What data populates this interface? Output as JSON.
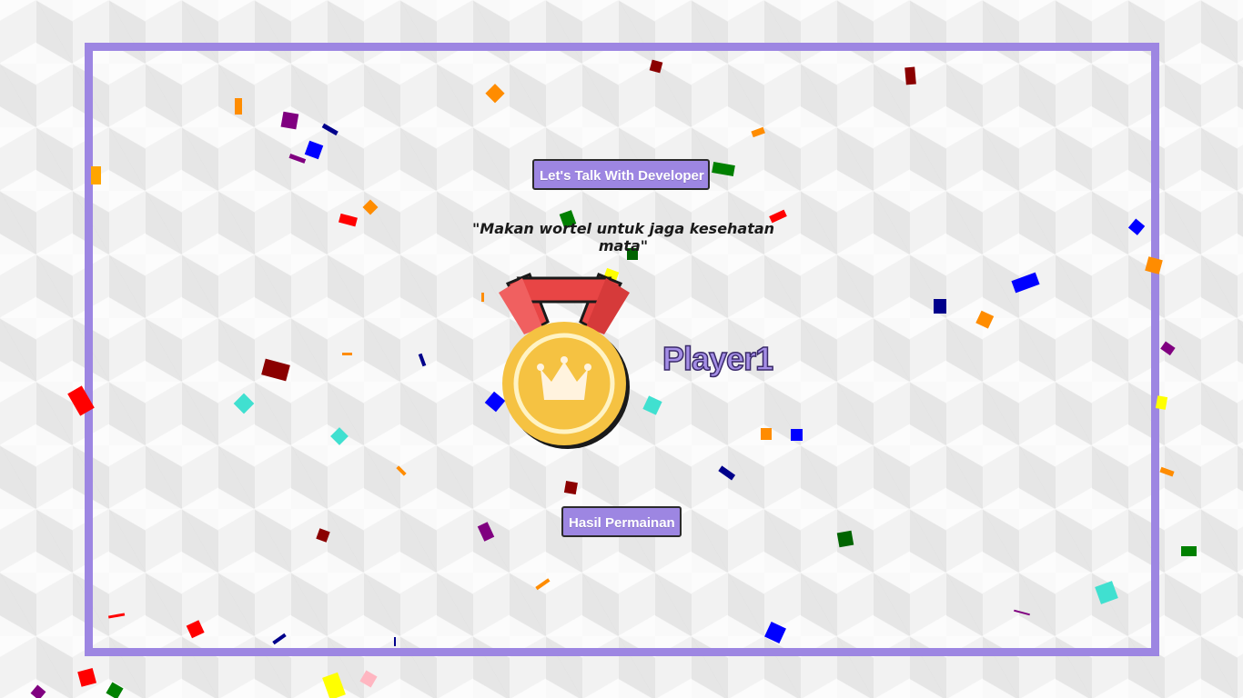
{
  "buttons": {
    "developer_label": "Let's Talk With Developer",
    "result_label": "Hasil Permainan"
  },
  "quote": "\"Makan wortel untuk jaga kesehatan mata\"",
  "winner": {
    "name": "Player1",
    "medal_icon": "gold-medal-crown-icon"
  },
  "colors": {
    "frame": "#9d86e2",
    "button_bg": "#9d86e2",
    "player_text": "#a48ee6",
    "medal_gold": "#f5c242",
    "ribbon_red": "#e84545"
  }
}
